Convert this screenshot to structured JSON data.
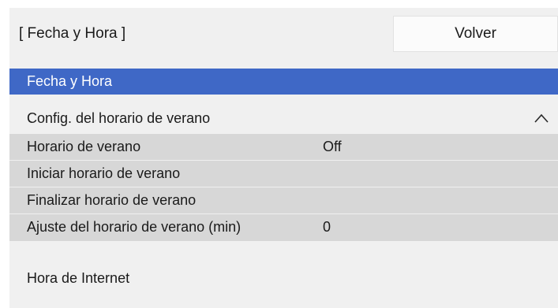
{
  "header": {
    "title": "[ Fecha y Hora ]",
    "back_label": "Volver"
  },
  "menu": {
    "selected_item": "Fecha y Hora",
    "section_label": "Config. del horario de verano",
    "section_state": "expanded",
    "chevron_icon": "chevron-up-icon",
    "sub_items": [
      {
        "label": "Horario de verano",
        "value": "Off"
      },
      {
        "label": "Iniciar horario de verano",
        "value": ""
      },
      {
        "label": "Finalizar horario de verano",
        "value": ""
      },
      {
        "label": "Ajuste del horario de verano (min)",
        "value": "0"
      }
    ],
    "last_item": "Hora de Internet"
  },
  "colors": {
    "selected_bg": "#3f68c6",
    "panel_bg": "#f0f0f0",
    "sub_bg": "#d7d7d7"
  }
}
